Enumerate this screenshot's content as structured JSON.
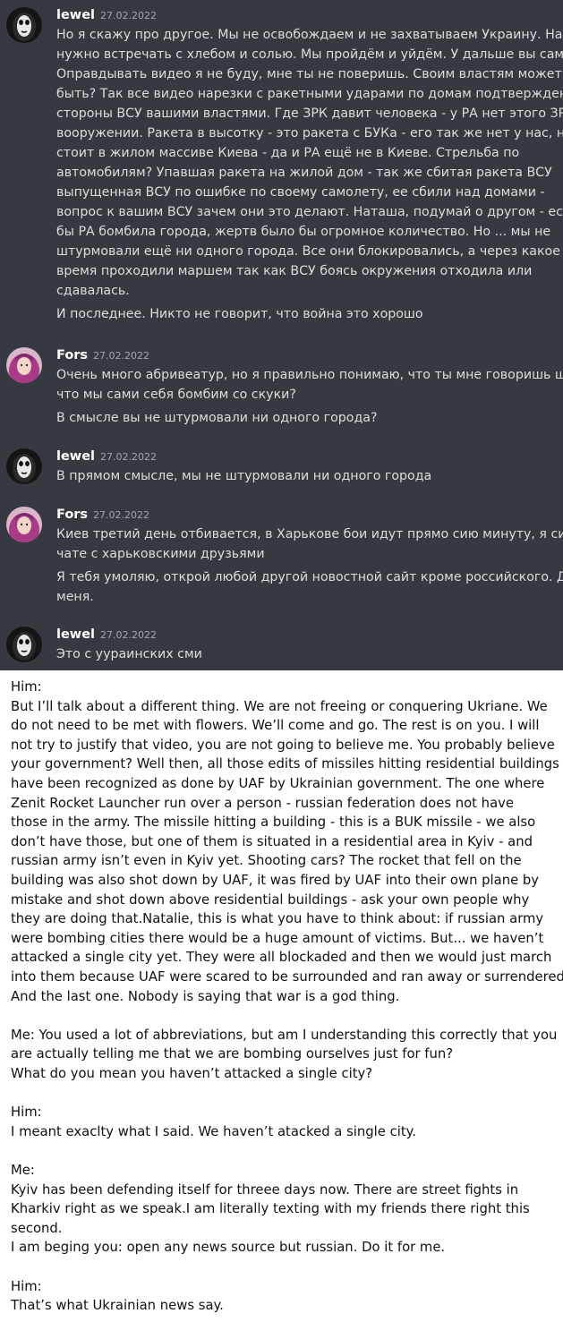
{
  "chat": {
    "messages": [
      {
        "author": "lewel",
        "timestamp": "27.02.2022",
        "avatar": "skull-mask-avatar",
        "paragraphs": [
          [
            "Но я скажу про другое. Мы не освобождаем и не захватываем Украину. Нас не",
            "нужно встречать с хлебом и солью. Мы пройдём и уйдём. У дальше вы сами.",
            "Оправдывать видео я не буду, мне ты не поверишь. Своим властям может",
            "быть? Так все видео нарезки с ракетными ударами по домам подтверждены со",
            "стороны ВСУ вашими властями. Где ЗРК давит человека - у РА нет этого ЗРК на",
            "вооружении. Ракета в высотку - это ракета с БУКа - его так же нет у нас, но он",
            "стоит в жилом массиве Киева - да и РА ещё не в Киеве. Стрельба по",
            "автомобилям? Упавшая ракета на жилой дом - так же сбитая ракета ВСУ",
            "выпущенная ВСУ по ошибке по своему самолету, ее сбили над домами -",
            "вопрос к вашим ВСУ зачем они это делают. Наташа, подумай о другом - если",
            "бы РА бомбила города, жертв было бы огромное количество. Но ... мы не",
            "штурмовали ещё ни одного города. Все они блокировались, а через какое то",
            "время проходили маршем так как ВСУ боясь окружения отходила или",
            "сдавалась."
          ],
          [
            "И последнее. Никто не говорит, что война это хорошо"
          ]
        ]
      },
      {
        "author": "Fors",
        "timestamp": "27.02.2022",
        "avatar": "pink-hair-avatar",
        "paragraphs": [
          [
            "Очень много абривеатур, но я правильно понимаю, что ты мне говоришь щас,",
            "что мы сами себя бомбим со скуки?"
          ],
          [
            "В смысле вы не штурмовали ни одного города?"
          ]
        ]
      },
      {
        "author": "lewel",
        "timestamp": "27.02.2022",
        "avatar": "skull-mask-avatar",
        "paragraphs": [
          [
            "В прямом смысле, мы не штурмовали ни одного города"
          ]
        ]
      },
      {
        "author": "Fors",
        "timestamp": "27.02.2022",
        "avatar": "pink-hair-avatar",
        "paragraphs": [
          [
            "Киев третий день отбивается, в Харькове бои идут прямо сию минуту, я сижу в",
            "чате с харьковскими друзьями"
          ],
          [
            "Я тебя умоляю, открой любой другой новостной сайт кроме российского. Для",
            "меня."
          ]
        ]
      },
      {
        "author": "lewel",
        "timestamp": "27.02.2022",
        "avatar": "skull-mask-avatar",
        "paragraphs": [
          [
            "Это с уураинских сми"
          ]
        ]
      }
    ]
  },
  "translation": {
    "lines": [
      "Him:",
      "But I’ll talk about a different thing. We are not freeing or conquering Ukriane. We",
      "do not need to be met with flowers. We’ll come and go. The rest is on you. I will",
      "not try to justify that video, you are not going to believe me. You probably believe",
      "your government? Well then,  all those edits of missiles hitting residential buildings",
      "have been recognized as done by UAF by Ukrainian government. The one where",
      "Zenit Rocket Launcher run over a person - russian federation does not have",
      "those in the army. The missile hitting a building - this is a BUK missile - we also",
      "don’t have those, but one of them is situated in a residential area in Kyiv - and",
      "russian army isn’t even in Kyiv yet. Shooting cars? The rocket that fell on the",
      "building was also shot down by UAF, it was fired by UAF into their own plane by",
      "mistake and shot  down above residential buildings - ask your own people why",
      "they are doing that.Natalie, this is what you have to think about: if russian army",
      "were bombing cities there would be a huge amount of victims. But... we haven’t",
      "attacked a single city  yet. They were all blockaded and then we would just march",
      "into them because UAF were scared to be surrounded and ran away or surrendered.",
      "And the last one. Nobody is saying that war is a god thing.",
      "",
      "Me: You used a lot of abbreviations, but am I understanding this correctly that you",
      "are actually telling me that we are bombing ourselves just for fun?",
      "What do you mean you haven’t attacked a single city?",
      "",
      "Him:",
      "I meant exaclty what I said. We haven’t atacked a single city.",
      "",
      "Me:",
      "Kyiv has been defending itself for threee days now. There are street fights in",
      "Kharkiv right as we speak.I am literally texting with my friends there right this",
      "second.",
      "I am beging you: open any news source but russian. Do it for me.",
      "",
      "Him:",
      "That’s what Ukrainian news say."
    ]
  }
}
